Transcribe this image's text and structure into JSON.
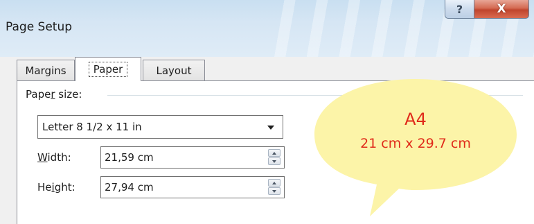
{
  "window": {
    "title": "Page Setup",
    "help_glyph": "?",
    "close_glyph": "X"
  },
  "tabs": [
    {
      "label": "Margins",
      "active": false
    },
    {
      "label": "Paper",
      "active": true
    },
    {
      "label": "Layout",
      "active": false
    }
  ],
  "paper": {
    "group_label_pre": "Pape",
    "group_label_key": "r",
    "group_label_post": " size:",
    "size_value": "Letter 8 1/2 x 11 in",
    "width_label_key": "W",
    "width_label_rest": "idth:",
    "width_value": "21,59 cm",
    "height_label_pre": "He",
    "height_label_key": "i",
    "height_label_post": "ght:",
    "height_value": "27,94 cm"
  },
  "callout": {
    "line1": "A4",
    "line2": "21 cm x 29.7 cm",
    "color": "#e02a1a",
    "fill": "#fcf4a8"
  }
}
